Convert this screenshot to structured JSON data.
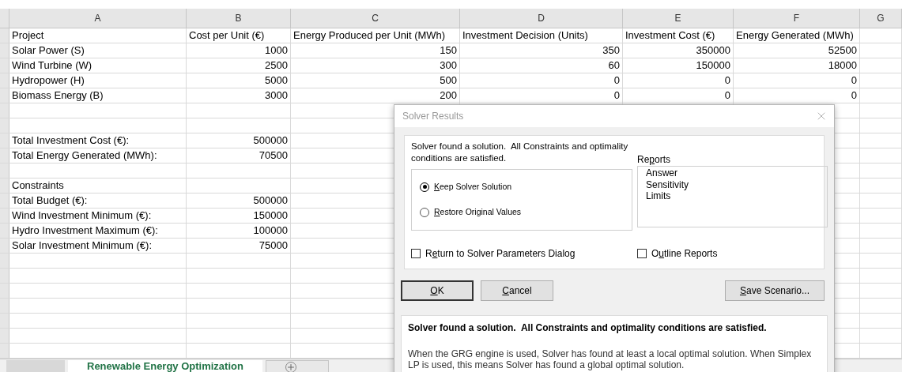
{
  "columns": [
    "A",
    "B",
    "C",
    "D",
    "E",
    "F",
    "G"
  ],
  "rows": [
    {
      "kind": "header",
      "cells": [
        "Project",
        "Cost per Unit (€)",
        "Energy Produced per Unit (MWh)",
        "Investment Decision (Units)",
        "Investment Cost (€)",
        "Energy Generated (MWh)"
      ]
    },
    {
      "kind": "data",
      "cells": [
        "Solar Power (S)",
        "1000",
        "150",
        "350",
        "350000",
        "52500"
      ]
    },
    {
      "kind": "data",
      "cells": [
        "Wind Turbine (W)",
        "2500",
        "300",
        "60",
        "150000",
        "18000"
      ]
    },
    {
      "kind": "data",
      "cells": [
        "Hydropower (H)",
        "5000",
        "500",
        "0",
        "0",
        "0"
      ]
    },
    {
      "kind": "data",
      "cells": [
        "Biomass Energy (B)",
        "3000",
        "200",
        "0",
        "0",
        "0"
      ]
    },
    {
      "kind": "blank"
    },
    {
      "kind": "blank"
    },
    {
      "kind": "data",
      "cells": [
        "Total Investment Cost (€):",
        "500000"
      ]
    },
    {
      "kind": "data",
      "cells": [
        "Total Energy Generated (MWh):",
        "70500"
      ]
    },
    {
      "kind": "blank"
    },
    {
      "kind": "data",
      "cells": [
        "Constraints"
      ]
    },
    {
      "kind": "data",
      "cells": [
        "Total Budget (€):",
        "500000"
      ]
    },
    {
      "kind": "data",
      "cells": [
        "Wind Investment Minimum (€):",
        "150000"
      ]
    },
    {
      "kind": "data",
      "cells": [
        "Hydro Investment Maximum (€):",
        "100000"
      ]
    },
    {
      "kind": "data",
      "cells": [
        "Solar Investment Minimum (€):",
        "75000"
      ]
    }
  ],
  "sheet_tabs": [
    {
      "selected": false
    },
    {
      "label": "Renewable Energy Optimization",
      "selected": true
    }
  ],
  "dialog": {
    "title": "Solver Results",
    "message": "Solver found a solution.  All Constraints and optimality conditions are satisfied.",
    "options": [
      {
        "label_parts": [
          {
            "text": "K",
            "access_key": true
          },
          {
            "text": "eep Solver Solution",
            "access_key": false
          }
        ],
        "selected": true
      },
      {
        "label_parts": [
          {
            "text": "R",
            "access_key": true
          },
          {
            "text": "estore Original Values",
            "access_key": false
          }
        ],
        "selected": false
      }
    ],
    "reports_label_parts": [
      {
        "text": "Re",
        "access_key": false
      },
      {
        "text": "p",
        "access_key": true
      },
      {
        "text": "orts",
        "access_key": false
      }
    ],
    "reports": [
      "Answer",
      "Sensitivity",
      "Limits"
    ],
    "checkboxes": [
      {
        "label_parts": [
          {
            "text": "R",
            "access_key": false
          },
          {
            "text": "e",
            "access_key": true
          },
          {
            "text": "turn to Solver Parameters Dialog",
            "access_key": false
          }
        ],
        "checked": false
      },
      {
        "label_parts": [
          {
            "text": "O",
            "access_key": false
          },
          {
            "text": "u",
            "access_key": true
          },
          {
            "text": "tline Reports",
            "access_key": false
          }
        ],
        "checked": false
      }
    ],
    "buttons": [
      {
        "label_parts": [
          {
            "text": "O",
            "access_key": true
          },
          {
            "text": "K",
            "access_key": false
          }
        ],
        "kind": "default"
      },
      {
        "label_parts": [
          {
            "text": "C",
            "access_key": true
          },
          {
            "text": "ancel",
            "access_key": false
          }
        ],
        "kind": "normal"
      },
      {
        "label_parts": [
          {
            "text": "S",
            "access_key": true
          },
          {
            "text": "ave Scenario...",
            "access_key": false
          }
        ],
        "kind": "normal"
      }
    ],
    "info_title": "Solver found a solution.  All Constraints and optimality conditions are satisfied.",
    "info_body": "When the GRG engine is used, Solver has found at least a local optimal solution. When Simplex LP is used, this means Solver has found a global optimal solution."
  }
}
